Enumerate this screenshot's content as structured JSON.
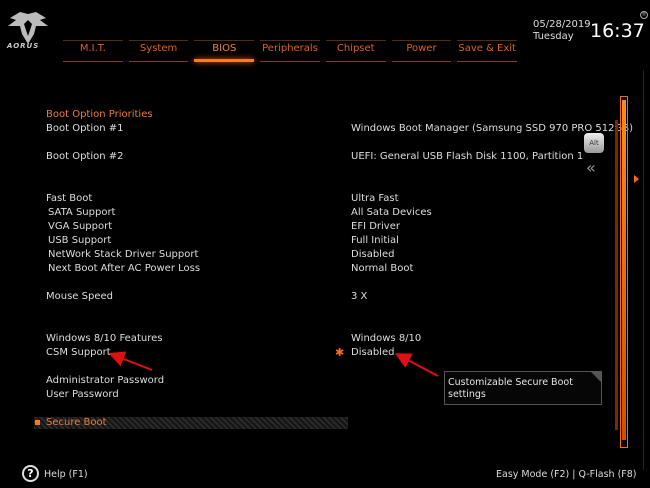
{
  "header": {
    "logo_text": "AORUS",
    "date": "05/28/2019",
    "day": "Tuesday",
    "time": "16:37",
    "reg_mark": "®"
  },
  "tabs": [
    {
      "label": "M.I.T.",
      "active": false
    },
    {
      "label": "System",
      "active": false
    },
    {
      "label": "BIOS",
      "active": true
    },
    {
      "label": "Peripherals",
      "active": false
    },
    {
      "label": "Chipset",
      "active": false
    },
    {
      "label": "Power",
      "active": false
    },
    {
      "label": "Save & Exit",
      "active": false
    }
  ],
  "settings": {
    "section_title": "Boot Option Priorities",
    "boot1": {
      "label": "Boot Option #1",
      "value": "Windows Boot Manager (Samsung SSD 970 PRO 512GB)"
    },
    "boot2": {
      "label": "Boot Option #2",
      "value": "UEFI: General USB Flash Disk 1100, Partition 1"
    },
    "fast_boot": {
      "label": "Fast Boot",
      "value": "Ultra Fast"
    },
    "sata": {
      "label": "SATA Support",
      "value": "All Sata Devices"
    },
    "vga": {
      "label": "VGA Support",
      "value": "EFI Driver"
    },
    "usb": {
      "label": "USB Support",
      "value": "Full Initial"
    },
    "network": {
      "label": "NetWork Stack Driver Support",
      "value": "Disabled"
    },
    "next_boot": {
      "label": "Next Boot After AC Power Loss",
      "value": "Normal Boot"
    },
    "mouse": {
      "label": "Mouse Speed",
      "value": "3 X"
    },
    "win_features": {
      "label": "Windows 8/10 Features",
      "value": "Windows 8/10"
    },
    "csm": {
      "label": "CSM Support",
      "value": "Disabled"
    },
    "admin_pw": {
      "label": "Administrator Password"
    },
    "user_pw": {
      "label": "User Password"
    },
    "secure_boot": {
      "label": "Secure Boot"
    }
  },
  "tooltip": {
    "line1": "Customizable Secure Boot",
    "line2": "settings"
  },
  "side": {
    "alt_label": "Alt",
    "chevron": "«"
  },
  "footer": {
    "help_icon": "?",
    "help_label": "Help (F1)",
    "modes": "Easy Mode (F2)  |  Q-Flash (F8)"
  },
  "colors": {
    "accent": "#ff7a1a",
    "section": "#f07a30",
    "annotation": "#e01010"
  }
}
